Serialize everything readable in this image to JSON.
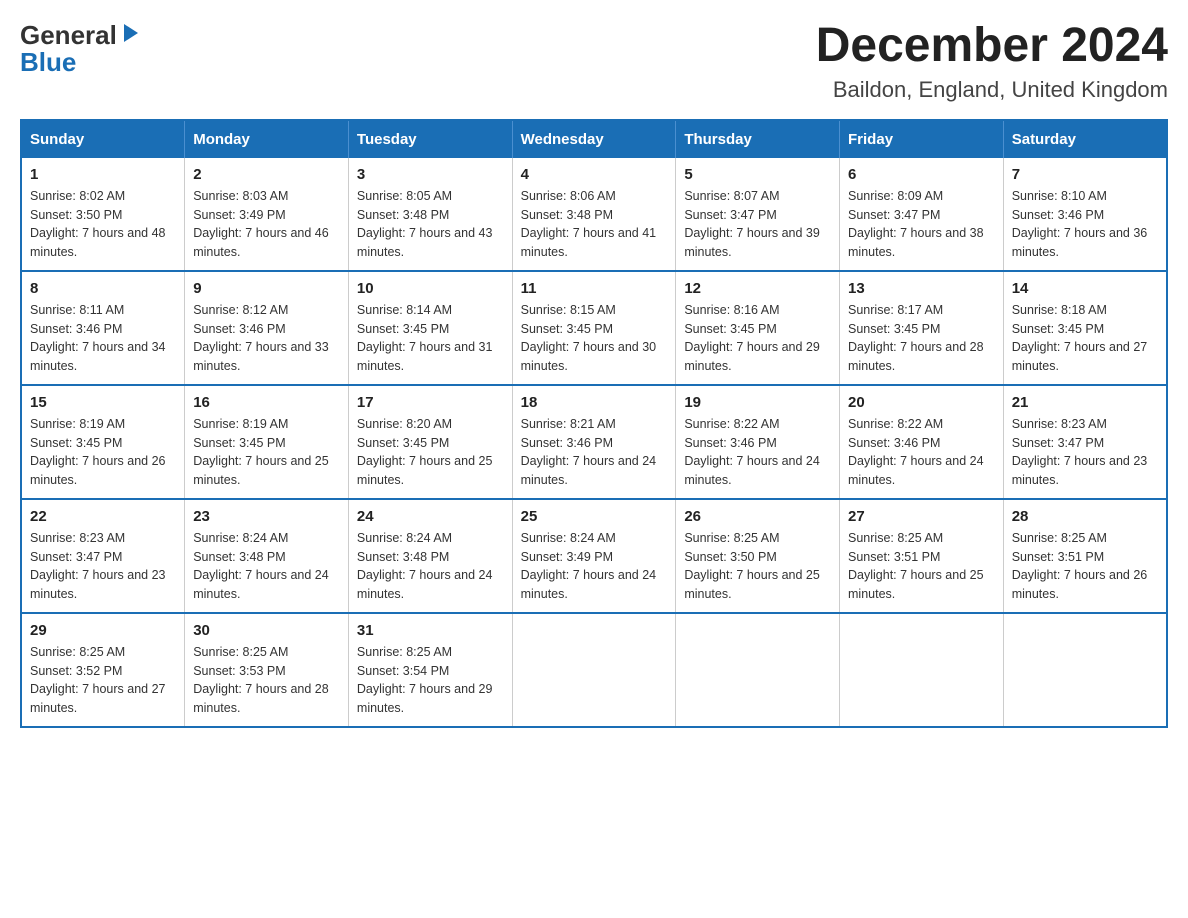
{
  "header": {
    "logo_general": "General",
    "logo_blue": "Blue",
    "month_title": "December 2024",
    "location": "Baildon, England, United Kingdom"
  },
  "days_of_week": [
    "Sunday",
    "Monday",
    "Tuesday",
    "Wednesday",
    "Thursday",
    "Friday",
    "Saturday"
  ],
  "weeks": [
    [
      {
        "day": "1",
        "sunrise": "Sunrise: 8:02 AM",
        "sunset": "Sunset: 3:50 PM",
        "daylight": "Daylight: 7 hours and 48 minutes."
      },
      {
        "day": "2",
        "sunrise": "Sunrise: 8:03 AM",
        "sunset": "Sunset: 3:49 PM",
        "daylight": "Daylight: 7 hours and 46 minutes."
      },
      {
        "day": "3",
        "sunrise": "Sunrise: 8:05 AM",
        "sunset": "Sunset: 3:48 PM",
        "daylight": "Daylight: 7 hours and 43 minutes."
      },
      {
        "day": "4",
        "sunrise": "Sunrise: 8:06 AM",
        "sunset": "Sunset: 3:48 PM",
        "daylight": "Daylight: 7 hours and 41 minutes."
      },
      {
        "day": "5",
        "sunrise": "Sunrise: 8:07 AM",
        "sunset": "Sunset: 3:47 PM",
        "daylight": "Daylight: 7 hours and 39 minutes."
      },
      {
        "day": "6",
        "sunrise": "Sunrise: 8:09 AM",
        "sunset": "Sunset: 3:47 PM",
        "daylight": "Daylight: 7 hours and 38 minutes."
      },
      {
        "day": "7",
        "sunrise": "Sunrise: 8:10 AM",
        "sunset": "Sunset: 3:46 PM",
        "daylight": "Daylight: 7 hours and 36 minutes."
      }
    ],
    [
      {
        "day": "8",
        "sunrise": "Sunrise: 8:11 AM",
        "sunset": "Sunset: 3:46 PM",
        "daylight": "Daylight: 7 hours and 34 minutes."
      },
      {
        "day": "9",
        "sunrise": "Sunrise: 8:12 AM",
        "sunset": "Sunset: 3:46 PM",
        "daylight": "Daylight: 7 hours and 33 minutes."
      },
      {
        "day": "10",
        "sunrise": "Sunrise: 8:14 AM",
        "sunset": "Sunset: 3:45 PM",
        "daylight": "Daylight: 7 hours and 31 minutes."
      },
      {
        "day": "11",
        "sunrise": "Sunrise: 8:15 AM",
        "sunset": "Sunset: 3:45 PM",
        "daylight": "Daylight: 7 hours and 30 minutes."
      },
      {
        "day": "12",
        "sunrise": "Sunrise: 8:16 AM",
        "sunset": "Sunset: 3:45 PM",
        "daylight": "Daylight: 7 hours and 29 minutes."
      },
      {
        "day": "13",
        "sunrise": "Sunrise: 8:17 AM",
        "sunset": "Sunset: 3:45 PM",
        "daylight": "Daylight: 7 hours and 28 minutes."
      },
      {
        "day": "14",
        "sunrise": "Sunrise: 8:18 AM",
        "sunset": "Sunset: 3:45 PM",
        "daylight": "Daylight: 7 hours and 27 minutes."
      }
    ],
    [
      {
        "day": "15",
        "sunrise": "Sunrise: 8:19 AM",
        "sunset": "Sunset: 3:45 PM",
        "daylight": "Daylight: 7 hours and 26 minutes."
      },
      {
        "day": "16",
        "sunrise": "Sunrise: 8:19 AM",
        "sunset": "Sunset: 3:45 PM",
        "daylight": "Daylight: 7 hours and 25 minutes."
      },
      {
        "day": "17",
        "sunrise": "Sunrise: 8:20 AM",
        "sunset": "Sunset: 3:45 PM",
        "daylight": "Daylight: 7 hours and 25 minutes."
      },
      {
        "day": "18",
        "sunrise": "Sunrise: 8:21 AM",
        "sunset": "Sunset: 3:46 PM",
        "daylight": "Daylight: 7 hours and 24 minutes."
      },
      {
        "day": "19",
        "sunrise": "Sunrise: 8:22 AM",
        "sunset": "Sunset: 3:46 PM",
        "daylight": "Daylight: 7 hours and 24 minutes."
      },
      {
        "day": "20",
        "sunrise": "Sunrise: 8:22 AM",
        "sunset": "Sunset: 3:46 PM",
        "daylight": "Daylight: 7 hours and 24 minutes."
      },
      {
        "day": "21",
        "sunrise": "Sunrise: 8:23 AM",
        "sunset": "Sunset: 3:47 PM",
        "daylight": "Daylight: 7 hours and 23 minutes."
      }
    ],
    [
      {
        "day": "22",
        "sunrise": "Sunrise: 8:23 AM",
        "sunset": "Sunset: 3:47 PM",
        "daylight": "Daylight: 7 hours and 23 minutes."
      },
      {
        "day": "23",
        "sunrise": "Sunrise: 8:24 AM",
        "sunset": "Sunset: 3:48 PM",
        "daylight": "Daylight: 7 hours and 24 minutes."
      },
      {
        "day": "24",
        "sunrise": "Sunrise: 8:24 AM",
        "sunset": "Sunset: 3:48 PM",
        "daylight": "Daylight: 7 hours and 24 minutes."
      },
      {
        "day": "25",
        "sunrise": "Sunrise: 8:24 AM",
        "sunset": "Sunset: 3:49 PM",
        "daylight": "Daylight: 7 hours and 24 minutes."
      },
      {
        "day": "26",
        "sunrise": "Sunrise: 8:25 AM",
        "sunset": "Sunset: 3:50 PM",
        "daylight": "Daylight: 7 hours and 25 minutes."
      },
      {
        "day": "27",
        "sunrise": "Sunrise: 8:25 AM",
        "sunset": "Sunset: 3:51 PM",
        "daylight": "Daylight: 7 hours and 25 minutes."
      },
      {
        "day": "28",
        "sunrise": "Sunrise: 8:25 AM",
        "sunset": "Sunset: 3:51 PM",
        "daylight": "Daylight: 7 hours and 26 minutes."
      }
    ],
    [
      {
        "day": "29",
        "sunrise": "Sunrise: 8:25 AM",
        "sunset": "Sunset: 3:52 PM",
        "daylight": "Daylight: 7 hours and 27 minutes."
      },
      {
        "day": "30",
        "sunrise": "Sunrise: 8:25 AM",
        "sunset": "Sunset: 3:53 PM",
        "daylight": "Daylight: 7 hours and 28 minutes."
      },
      {
        "day": "31",
        "sunrise": "Sunrise: 8:25 AM",
        "sunset": "Sunset: 3:54 PM",
        "daylight": "Daylight: 7 hours and 29 minutes."
      },
      null,
      null,
      null,
      null
    ]
  ]
}
